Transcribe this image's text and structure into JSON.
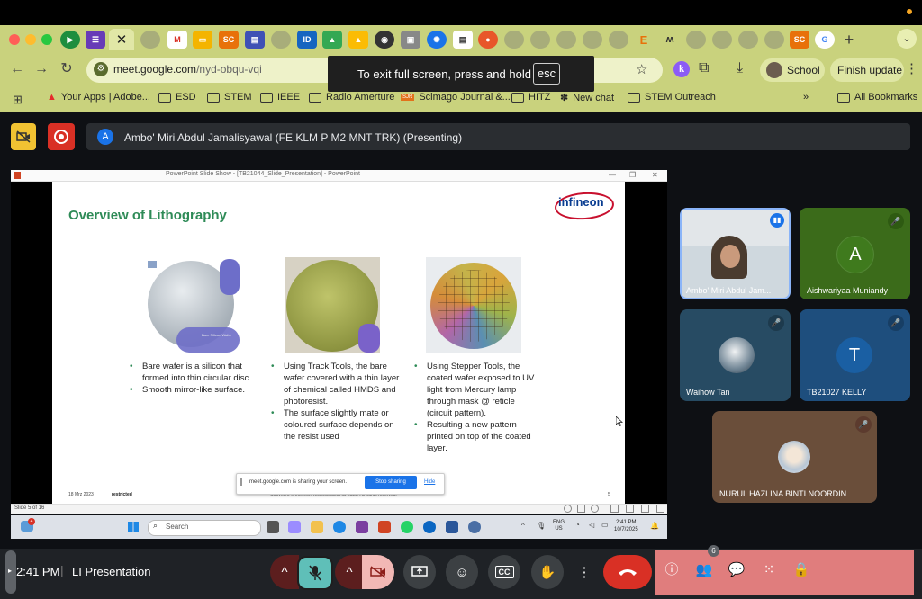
{
  "browser": {
    "tabs": [
      "Meet",
      "Forms",
      "Gmail",
      "Slides",
      "SC",
      "Docs",
      "ID",
      "Drive",
      "Drive",
      "Chrome",
      "Photo",
      "Settings",
      "Google",
      "Reddit",
      "E",
      "Mendeley",
      "SC",
      "Google"
    ],
    "new_tab_label": "+",
    "url_domain": "meet.google.com",
    "url_path": "/nyd-obqu-vqi",
    "profile_label": "School",
    "finish_update_label": "Finish update",
    "bookmarks": [
      {
        "label": "Your Apps | Adobe..."
      },
      {
        "label": "ESD"
      },
      {
        "label": "STEM"
      },
      {
        "label": "IEEE"
      },
      {
        "label": "Radio Amerture"
      },
      {
        "label": "Scimago Journal &..."
      },
      {
        "label": "HITZ"
      },
      {
        "label": "New chat"
      },
      {
        "label": "STEM Outreach"
      },
      {
        "label": "»"
      },
      {
        "label": "All Bookmarks"
      }
    ],
    "fullscreen_toast": {
      "text": "To exit full screen, press and hold",
      "key": "esc"
    }
  },
  "meet": {
    "presenting": {
      "avatar_letter": "A",
      "text": "Ambo' Miri Abdul Jamalisyawal (FE KLM P M2 MNT TRK) (Presenting)"
    },
    "participants": [
      {
        "name": "Ambo' Miri Abdul Jam...",
        "speaking": true
      },
      {
        "name": "Aishwariyaa Muniandy",
        "avatar_letter": "A",
        "muted": true
      },
      {
        "name": "Waihow Tan",
        "muted": true
      },
      {
        "name": "TB21027 KELLY",
        "avatar_letter": "T",
        "muted": true
      },
      {
        "name": "NURUL HAZLINA BINTI NOORDIN",
        "muted": true
      }
    ],
    "bottom": {
      "time": "2:41 PM",
      "separator": "|",
      "meeting_title": "LI Presentation",
      "people_count": "6"
    }
  },
  "ppt": {
    "window_title": "PowerPoint Slide Show - [TB21044_Slide_Presentation] - PowerPoint",
    "slide_title": "Overview of Lithography",
    "logo_text": "infineon",
    "image1_caption": "Bare Silicon Wafer",
    "col1": [
      "Bare wafer is a silicon that formed into thin circular disc.",
      "Smooth mirror-like surface."
    ],
    "col2": [
      "Using Track Tools, the bare wafer covered with a thin layer of chemical called HMDS and photoresist.",
      "The surface slightly mate or coloured surface depends on the resist used"
    ],
    "col3": [
      "Using Stepper Tools, the coated wafer exposed to UV light from Mercury lamp through mask @ reticle (circuit pattern).",
      "Resulting a new pattern printed on top of the coated layer."
    ],
    "footer_date": "18 Mrz 2023",
    "footer_restricted": "restricted",
    "footer_copyright": "Copyright © Infineon Technologies AG 2023. All rights reserved.",
    "footer_page": "5",
    "status": "Slide 5 of 16",
    "share_toast": {
      "text": "meet.google.com is sharing your screen.",
      "stop": "Stop sharing",
      "hide": "Hide"
    }
  },
  "taskbar": {
    "weather_badge": "4",
    "search_placeholder": "Search",
    "lang_1": "ENG",
    "lang_2": "US",
    "clock_time": "2:41 PM",
    "clock_date": "10/7/2025"
  }
}
